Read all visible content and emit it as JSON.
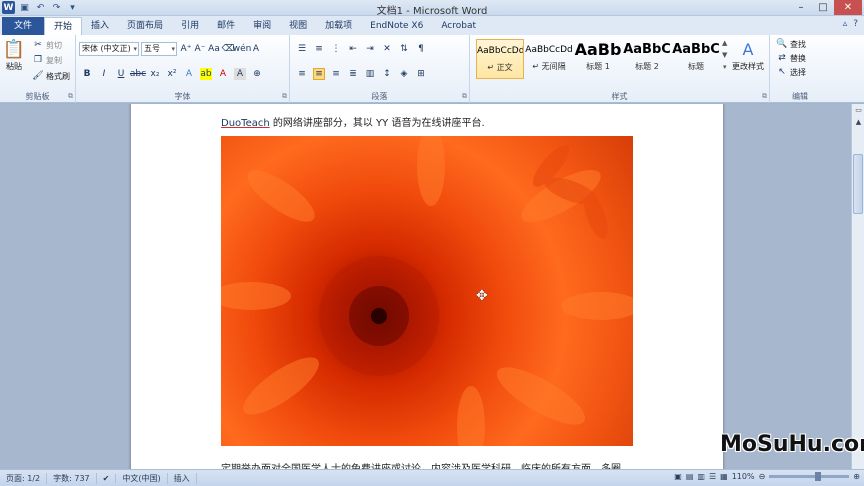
{
  "window": {
    "title": "文档1 - Microsoft Word",
    "app_icon_letter": "W",
    "qat": [
      "save-icon",
      "undo-icon",
      "redo-icon",
      "customize-icon"
    ],
    "controls": [
      "minimize-icon",
      "maximize-icon",
      "close-icon"
    ]
  },
  "tabs": {
    "file": "文件",
    "items": [
      "开始",
      "插入",
      "页面布局",
      "引用",
      "邮件",
      "审阅",
      "视图",
      "加载项",
      "EndNote X6",
      "Acrobat"
    ],
    "active": "开始"
  },
  "ribbon": {
    "clipboard": {
      "label": "剪贴板",
      "paste": "粘贴",
      "cut": "剪切",
      "copy": "复制",
      "format_painter": "格式刷"
    },
    "font": {
      "label": "字体",
      "font_name": "宋体 (中文正)",
      "font_size": "五号"
    },
    "paragraph": {
      "label": "段落"
    },
    "styles": {
      "label": "样式",
      "items": [
        {
          "sample": "AaBbCcDd",
          "name": "↵ 正文",
          "selected": true
        },
        {
          "sample": "AaBbCcDd",
          "name": "↵ 无间隔",
          "selected": false
        },
        {
          "sample": "AaBb",
          "name": "标题 1",
          "selected": false
        },
        {
          "sample": "AaBbC",
          "name": "标题 2",
          "selected": false
        },
        {
          "sample": "AaBbC",
          "name": "标题",
          "selected": false
        }
      ],
      "change_styles": "更改样式"
    },
    "editing": {
      "label": "编辑",
      "find": "查找",
      "replace": "替换",
      "select": "选择"
    }
  },
  "document": {
    "line1_link": "DuoTeach",
    "line1_rest": " 的网络讲座部分，其以 YY 语音为在线讲座平台.",
    "line2": "定期举办面对全国医学人士的免费讲座或讨论。内容涉及医学科研、临床的所有方面。多圈"
  },
  "watermark": "MoSuHu.com",
  "status": {
    "page": "页面: 1/2",
    "words": "字数: 737",
    "language": "中文(中国)",
    "mode": "插入",
    "zoom": "110%"
  }
}
